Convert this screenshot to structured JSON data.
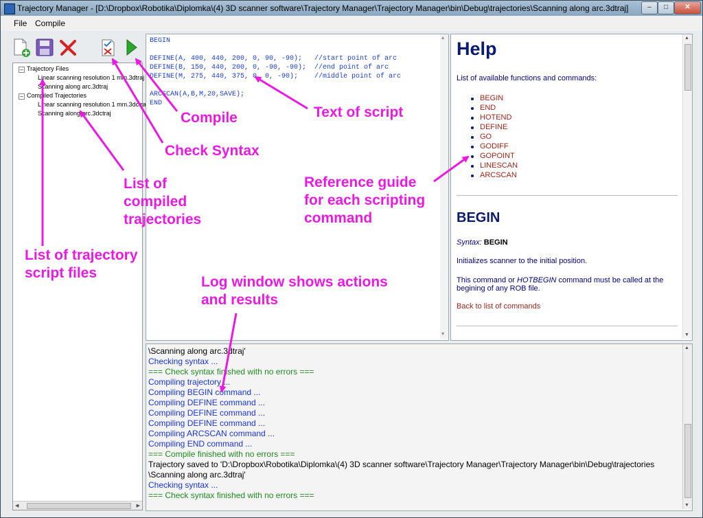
{
  "window": {
    "title": "Trajectory Manager - [D:\\Dropbox\\Robotika\\Diplomka\\(4) 3D scanner software\\Trajectory Manager\\Trajectory Manager\\bin\\Debug\\trajectories\\Scanning along arc.3dtraj]"
  },
  "menu": {
    "file": "File",
    "compile": "Compile"
  },
  "tree": {
    "group1": "Trajectory Files",
    "files": [
      "Linear scanning resolution 1 mm.3dtraj",
      "Scanning along arc.3dtraj"
    ],
    "group2": "Compiled Trajectories",
    "compiled": [
      "Linear scanning resolution 1 mm.3dctraj",
      "Scanning along arc.3dctraj"
    ]
  },
  "script": [
    "BEGIN",
    "",
    "DEFINE(A, 400, 440, 200, 0, 90, -90);   //start point of arc",
    "DEFINE(B, 150, 440, 200, 0, -90, -90);  //end point of arc",
    "DEFINE(M, 275, 440, 375, 0, 0, -90);    //middle point of arc",
    "",
    "ARCSCAN(A,B,M,20,SAVE);",
    "END"
  ],
  "help": {
    "title": "Help",
    "intro": "List of available functions and commands:",
    "commands": [
      "BEGIN",
      "END",
      "HOTEND",
      "DEFINE",
      "GO",
      "GODIFF",
      "GOPOINT",
      "LINESCAN",
      "ARCSCAN"
    ],
    "section_title": "BEGIN",
    "syntax_label": "Syntax:",
    "syntax_value": "BEGIN",
    "desc1": "Initializes scanner to the initial position.",
    "desc2_a": "This command or ",
    "desc2_em": "HOTBEGIN",
    "desc2_b": " command must be called at the",
    "desc2_c": "begining of any ROB file.",
    "back_link": "Back to list of commands"
  },
  "log": [
    {
      "text": "\\Scanning along arc.3dtraj'",
      "color": "#000000"
    },
    {
      "text": "Checking syntax ...",
      "color": "#1b35d6"
    },
    {
      "text": "=== Check syntax finished with no errors ===",
      "color": "#1f8a1f"
    },
    {
      "text": "Compiling trajectory ...",
      "color": "#1b35d6"
    },
    {
      "text": "Compiling BEGIN command ...",
      "color": "#1b35d6"
    },
    {
      "text": "Compiling DEFINE command ...",
      "color": "#1b35d6"
    },
    {
      "text": "Compiling DEFINE command ...",
      "color": "#1b35d6"
    },
    {
      "text": "Compiling DEFINE command ...",
      "color": "#1b35d6"
    },
    {
      "text": "Compiling ARCSCAN command ...",
      "color": "#1b35d6"
    },
    {
      "text": "Compiling END command ...",
      "color": "#1b35d6"
    },
    {
      "text": "=== Compile finished with no errors ===",
      "color": "#1f8a1f"
    },
    {
      "text": "Trajectory saved to 'D:\\Dropbox\\Robotika\\Diplomka\\(4) 3D scanner software\\Trajectory Manager\\Trajectory Manager\\bin\\Debug\\trajectories",
      "color": "#000000"
    },
    {
      "text": "\\Scanning along arc.3dtraj'",
      "color": "#000000"
    },
    {
      "text": "Checking syntax ...",
      "color": "#1b35d6"
    },
    {
      "text": "=== Check syntax finished with no errors ===",
      "color": "#1f8a1f"
    }
  ],
  "annotations": {
    "compile": "Compile",
    "text_of_script": "Text of script",
    "check_syntax": "Check Syntax",
    "compiled_list": [
      "List of",
      "compiled",
      "trajectories"
    ],
    "reference": [
      "Reference guide",
      "for each scripting",
      "command"
    ],
    "script_files": [
      "List of trajectory",
      "script files"
    ],
    "log_window": [
      "Log window shows actions",
      "and results"
    ]
  },
  "colors": {
    "annotation": "#ea1ae3",
    "command_link": "#a0261a",
    "help_text": "#000080"
  }
}
